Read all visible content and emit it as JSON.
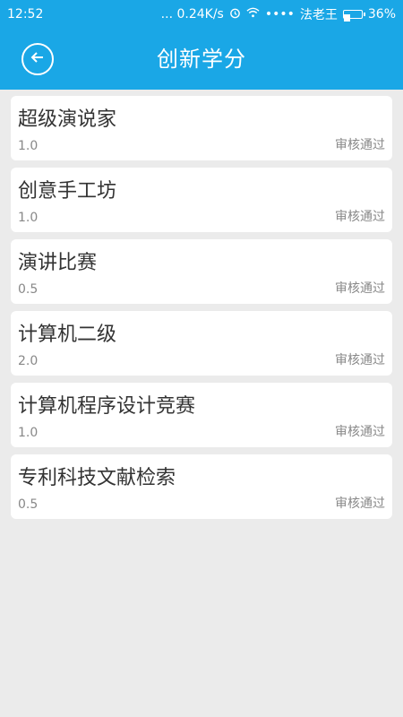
{
  "status_bar": {
    "time": "12:52",
    "network_speed": "... 0.24K/s",
    "alarm_icon": "alarm-icon",
    "wifi_icon": "wifi-icon",
    "signal": "••••",
    "carrier": "法老王",
    "battery_percent": "36%",
    "battery_level": 0.36
  },
  "header": {
    "title": "创新学分",
    "back_icon": "back-arrow-icon"
  },
  "items": [
    {
      "title": "超级演说家",
      "credit": "1.0",
      "status": "审核通过"
    },
    {
      "title": "创意手工坊",
      "credit": "1.0",
      "status": "审核通过"
    },
    {
      "title": "演讲比赛",
      "credit": "0.5",
      "status": "审核通过"
    },
    {
      "title": "计算机二级",
      "credit": "2.0",
      "status": "审核通过"
    },
    {
      "title": "计算机程序设计竞赛",
      "credit": "1.0",
      "status": "审核通过"
    },
    {
      "title": "专利科技文献检索",
      "credit": "0.5",
      "status": "审核通过"
    }
  ],
  "colors": {
    "primary": "#1aa7e6",
    "background": "#ebebeb",
    "card": "#ffffff"
  }
}
